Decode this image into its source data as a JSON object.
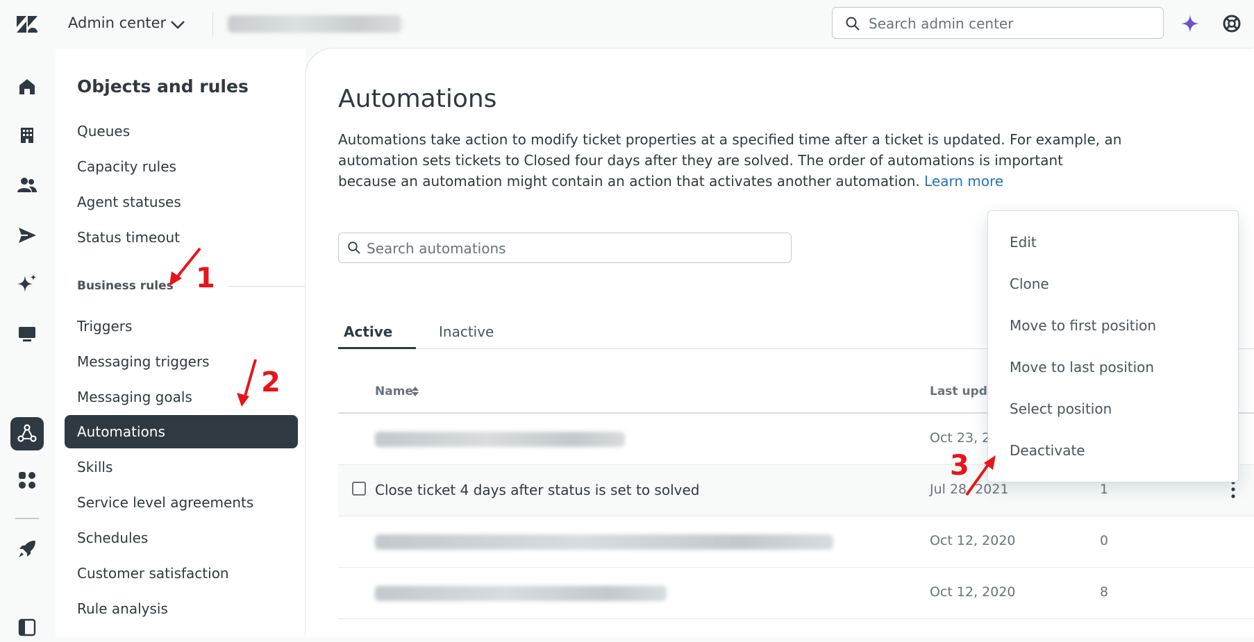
{
  "topbar": {
    "product": "Admin center",
    "search_placeholder": "Search admin center"
  },
  "rail": {
    "icons": [
      "home-icon",
      "building-icon",
      "people-icon",
      "send-icon",
      "sparkle-icon",
      "monitor-icon",
      "objects-rules-icon",
      "apps-icon",
      "rocket-icon",
      "panel-icon"
    ],
    "active": "objects-rules-icon"
  },
  "nav": {
    "title": "Objects and rules",
    "items_top": [
      "Queues",
      "Capacity rules",
      "Agent statuses",
      "Status timeout"
    ],
    "section": "Business rules",
    "items_bottom": [
      "Triggers",
      "Messaging triggers",
      "Messaging goals",
      "Automations",
      "Skills",
      "Service level agreements",
      "Schedules",
      "Customer satisfaction",
      "Rule analysis"
    ],
    "selected": "Automations"
  },
  "main": {
    "title": "Automations",
    "description": "Automations take action to modify ticket properties at a specified time after a ticket is updated. For example, an automation sets tickets to Closed four days after they are solved. The order of automations is important because an automation might contain an action that activates another automation.",
    "learn_more": "Learn more",
    "search_placeholder": "Search automations",
    "tabs": [
      "Active",
      "Inactive"
    ],
    "active_tab": "Active",
    "columns": [
      "Name",
      "Last updat"
    ],
    "rows": [
      {
        "name": "",
        "blurred": true,
        "date": "Oct 23, 2",
        "count": ""
      },
      {
        "name": "Close ticket 4 days after status is set to solved",
        "blurred": false,
        "date": "Jul 28, 2021",
        "count": "1"
      },
      {
        "name": "",
        "blurred": true,
        "date": "Oct 12, 2020",
        "count": "0"
      },
      {
        "name": "",
        "blurred": true,
        "date": "Oct 12, 2020",
        "count": "8"
      }
    ]
  },
  "menu": {
    "items": [
      "Edit",
      "Clone",
      "Move to first position",
      "Move to last position",
      "Select position",
      "Deactivate"
    ]
  },
  "annotations": [
    "1",
    "2",
    "3"
  ],
  "colors": {
    "accent": "#1f73b7",
    "dark": "#2f3941",
    "annotation": "#e8141c",
    "ai": "#6a4fc8"
  }
}
